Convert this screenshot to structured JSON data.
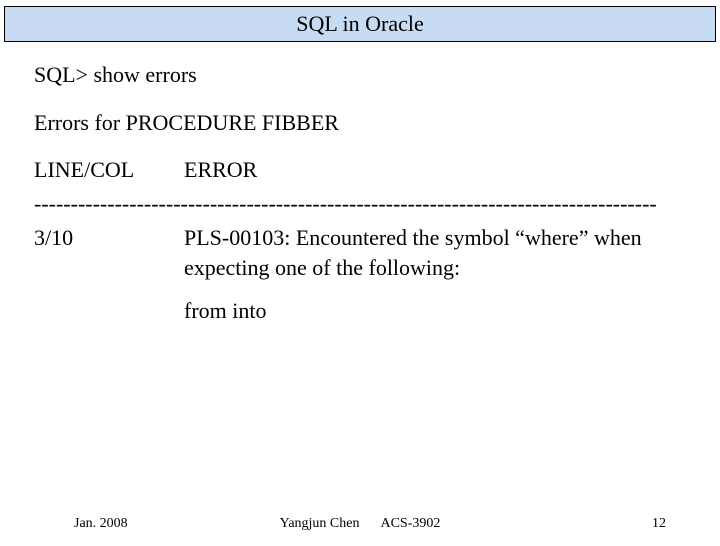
{
  "title": "SQL in Oracle",
  "prompt": "SQL> show errors",
  "errors_for": "Errors for PROCEDURE FIBBER",
  "col_header_left": "LINE/COL",
  "col_header_right": "ERROR",
  "separator": "-------------------------------------------------------------------------------------",
  "row_line": "3/10",
  "row_error": "PLS-00103: Encountered the symbol “where” when expecting one of the following:",
  "row_continuation": "from into",
  "footer": {
    "date": "Jan. 2008",
    "author": "Yangjun Chen",
    "course": "ACS-3902",
    "page": "12"
  }
}
